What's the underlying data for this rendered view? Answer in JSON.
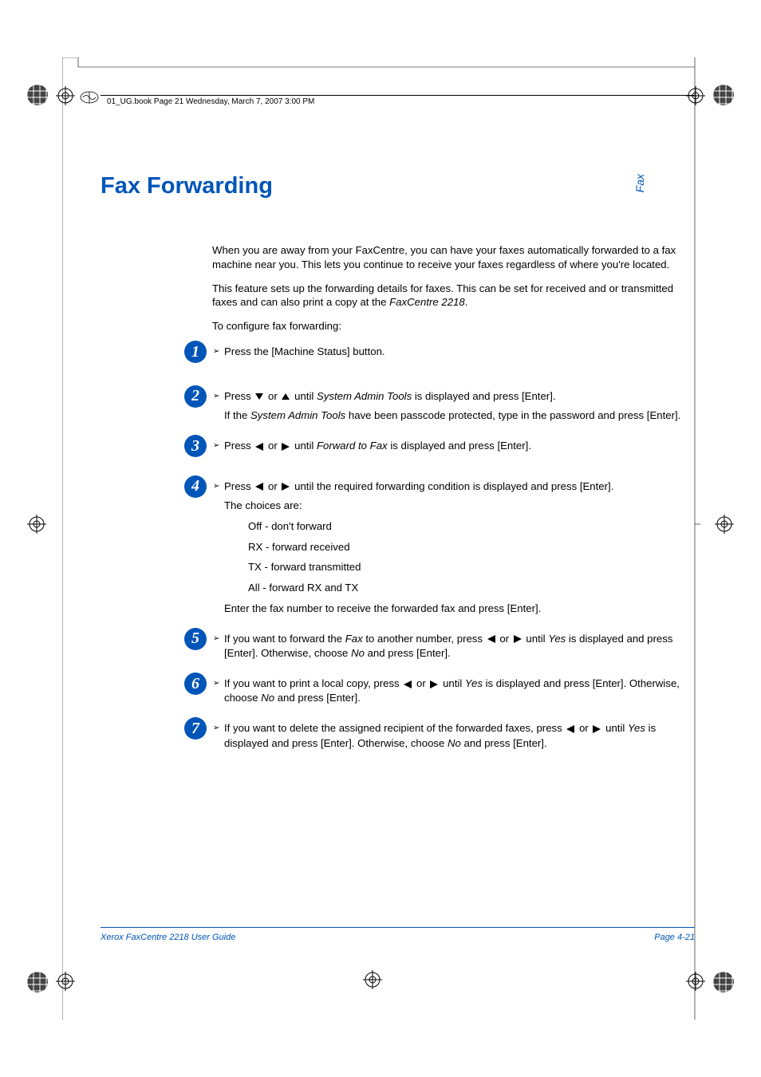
{
  "header": {
    "running": "01_UG.book  Page 21  Wednesday, March 7, 2007  3:00 PM"
  },
  "sideTab": "Fax",
  "title": "Fax Forwarding",
  "intro": {
    "p1": "When you are away from your FaxCentre, you can have your faxes automatically forwarded to a fax machine near you. This lets you continue to receive your faxes regardless of where you're located.",
    "p2a": "This feature sets up the forwarding details for faxes. This can be set for received and or transmitted faxes and can also print a copy at the ",
    "p2b": "FaxCentre 2218",
    "p2c": ".",
    "p3": "To configure fax forwarding:"
  },
  "steps": {
    "s1": {
      "num": "1",
      "line1": "Press the [Machine Status] button."
    },
    "s2": {
      "num": "2",
      "line1a": "Press ",
      "line1b": " or ",
      "line1c": " until ",
      "line1d": "System Admin Tools",
      "line1e": " is displayed and press [Enter].",
      "line2a": "If the ",
      "line2b": "System Admin Tools",
      "line2c": " have been passcode protected, type in the password and press [Enter]."
    },
    "s3": {
      "num": "3",
      "line1a": "Press ",
      "line1b": " or ",
      "line1c": " until ",
      "line1d": "Forward to Fax",
      "line1e": " is displayed and press [Enter]."
    },
    "s4": {
      "num": "4",
      "line1a": "Press ",
      "line1b": " or ",
      "line1c": " until the required forwarding condition is displayed and press [Enter].",
      "choicesLabel": "The choices are:",
      "c1": "Off - don't forward",
      "c2": "RX - forward received",
      "c3": "TX - forward transmitted",
      "c4": "All - forward RX and TX",
      "line3": "Enter the fax number to receive the forwarded fax and press [Enter]."
    },
    "s5": {
      "num": "5",
      "a": "If you want to forward the ",
      "b": "Fax",
      "c": " to another number, press ",
      "d": " or ",
      "e": " until ",
      "f": "Yes",
      "g": " is displayed and press [Enter]. Otherwise, choose ",
      "h": "No",
      "i": " and press [Enter]."
    },
    "s6": {
      "num": "6",
      "a": "If you want to print a local copy, press ",
      "b": " or ",
      "c": " until ",
      "d": "Yes",
      "e": " is displayed and press [Enter]. Otherwise, choose ",
      "f": "No",
      "g": " and press [Enter]."
    },
    "s7": {
      "num": "7",
      "a": "If you want to delete the assigned recipient of the forwarded faxes, press ",
      "b": " or ",
      "c": " until ",
      "d": "Yes",
      "e": " is displayed and press [Enter]. Otherwise, choose ",
      "f": "No",
      "g": " and press [Enter]."
    }
  },
  "footer": {
    "left": "Xerox FaxCentre 2218 User Guide",
    "right": "Page 4-21"
  }
}
